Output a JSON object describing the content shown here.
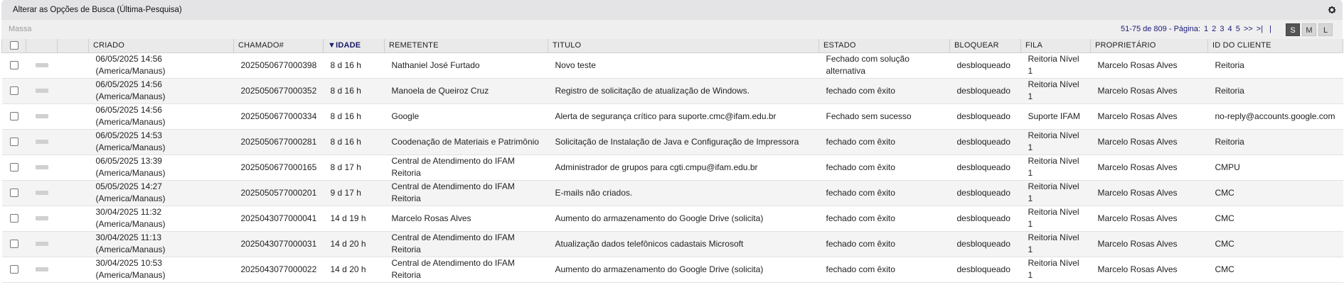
{
  "header": {
    "title": "Alterar as Opções de Busca (Última-Pesquisa)",
    "settings_icon": "gear-icon"
  },
  "toolbar": {
    "bulk_label": "Massa",
    "range_text": "51-75 de 809 - Página:",
    "pages": [
      "1",
      "2",
      "3",
      "4",
      "5",
      ">>",
      ">|"
    ],
    "size_options": [
      "S",
      "M",
      "L"
    ],
    "selected_size": "S"
  },
  "columns": {
    "criado": "CRIADO",
    "chamado": "CHAMADO#",
    "idade": "▼IDADE",
    "remetente": "REMETENTE",
    "titulo": "TITULO",
    "estado": "ESTADO",
    "bloquear": "BLOQUEAR",
    "fila": "FILA",
    "proprietario": "PROPRIETÁRIO",
    "cliente": "ID DO CLIENTE"
  },
  "rows": [
    {
      "criado": "06/05/2025 14:56\n(America/Manaus)",
      "chamado": "2025050677000398",
      "idade": "8 d 16 h",
      "remetente": "Nathaniel José Furtado",
      "titulo": "Novo teste",
      "estado": "Fechado com solução alternativa",
      "bloquear": "desbloqueado",
      "fila": "Reitoria Nível 1",
      "proprietario": "Marcelo Rosas Alves",
      "cliente": "Reitoria"
    },
    {
      "criado": "06/05/2025 14:56\n(America/Manaus)",
      "chamado": "2025050677000352",
      "idade": "8 d 16 h",
      "remetente": "Manoela de Queiroz Cruz",
      "titulo": "Registro de solicitação de atualização de Windows.",
      "estado": "fechado com êxito",
      "bloquear": "desbloqueado",
      "fila": "Reitoria Nível 1",
      "proprietario": "Marcelo Rosas Alves",
      "cliente": "Reitoria"
    },
    {
      "criado": "06/05/2025 14:56\n(America/Manaus)",
      "chamado": "2025050677000334",
      "idade": "8 d 16 h",
      "remetente": "Google",
      "titulo": "Alerta de segurança crítico para suporte.cmc@ifam.edu.br",
      "estado": "Fechado sem sucesso",
      "bloquear": "desbloqueado",
      "fila": "Suporte IFAM",
      "proprietario": "Marcelo Rosas Alves",
      "cliente": "no-reply@accounts.google.com"
    },
    {
      "criado": "06/05/2025 14:53\n(America/Manaus)",
      "chamado": "2025050677000281",
      "idade": "8 d 16 h",
      "remetente": "Coodenação de Materiais e Patrimônio",
      "titulo": "Solicitação de Instalação de Java e Configuração de Impressora",
      "estado": "fechado com êxito",
      "bloquear": "desbloqueado",
      "fila": "Reitoria Nível 1",
      "proprietario": "Marcelo Rosas Alves",
      "cliente": "Reitoria"
    },
    {
      "criado": "06/05/2025 13:39\n(America/Manaus)",
      "chamado": "2025050677000165",
      "idade": "8 d 17 h",
      "remetente": "Central de Atendimento do IFAM Reitoria",
      "titulo": "Administrador de grupos para cgti.cmpu@ifam.edu.br",
      "estado": "fechado com êxito",
      "bloquear": "desbloqueado",
      "fila": "Reitoria Nível 1",
      "proprietario": "Marcelo Rosas Alves",
      "cliente": "CMPU"
    },
    {
      "criado": "05/05/2025 14:27\n(America/Manaus)",
      "chamado": "2025050577000201",
      "idade": "9 d 17 h",
      "remetente": "Central de Atendimento do IFAM Reitoria",
      "titulo": "E-mails não criados.",
      "estado": "fechado com êxito",
      "bloquear": "desbloqueado",
      "fila": "Reitoria Nível 1",
      "proprietario": "Marcelo Rosas Alves",
      "cliente": "CMC"
    },
    {
      "criado": "30/04/2025 11:32\n(America/Manaus)",
      "chamado": "2025043077000041",
      "idade": "14 d 19 h",
      "remetente": "Marcelo Rosas Alves",
      "titulo": "Aumento do armazenamento do Google Drive (solicita)",
      "estado": "fechado com êxito",
      "bloquear": "desbloqueado",
      "fila": "Reitoria Nível 1",
      "proprietario": "Marcelo Rosas Alves",
      "cliente": "CMC"
    },
    {
      "criado": "30/04/2025 11:13\n(America/Manaus)",
      "chamado": "2025043077000031",
      "idade": "14 d 20 h",
      "remetente": "Central de Atendimento do IFAM Reitoria",
      "titulo": "Atualização dados telefônicos cadastais Microsoft",
      "estado": "fechado com êxito",
      "bloquear": "desbloqueado",
      "fila": "Reitoria Nível 1",
      "proprietario": "Marcelo Rosas Alves",
      "cliente": "CMC"
    },
    {
      "criado": "30/04/2025 10:53\n(America/Manaus)",
      "chamado": "2025043077000022",
      "idade": "14 d 20 h",
      "remetente": "Central de Atendimento do IFAM Reitoria",
      "titulo": "Aumento do armazenamento do Google Drive (solicita)",
      "estado": "fechado com êxito",
      "bloquear": "desbloqueado",
      "fila": "Reitoria Nível 1",
      "proprietario": "Marcelo Rosas Alves",
      "cliente": "CMC"
    }
  ]
}
